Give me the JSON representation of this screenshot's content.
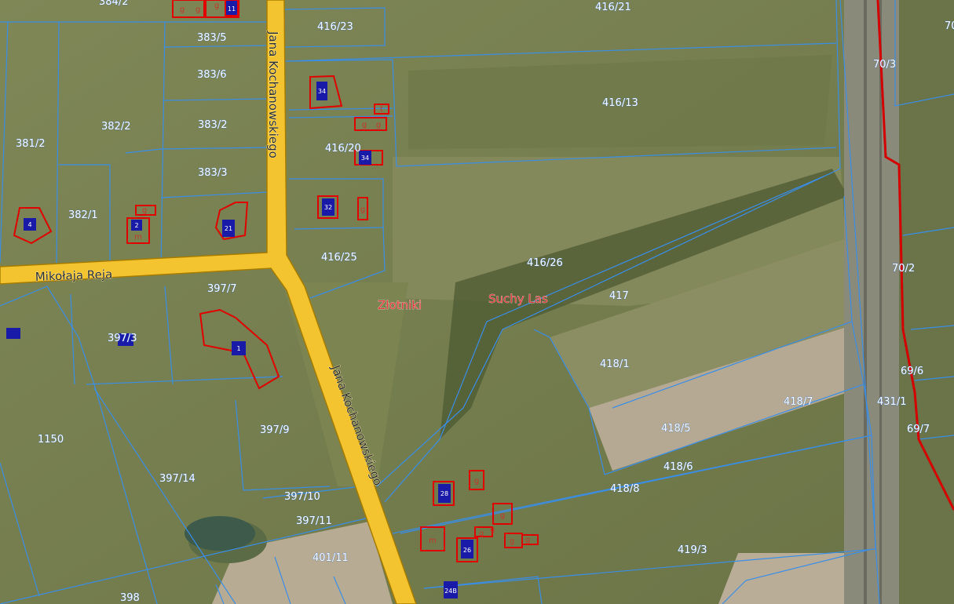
{
  "colors": {
    "parcel_boundary": "#3a8ee6",
    "road_fill": "#f4c430",
    "road_edge": "#a57c00",
    "building_outline": "#e00000",
    "building_fill_blue": "#1a1aa8",
    "railway_red": "#d40000",
    "place_label": "#e23a3a"
  },
  "streets": {
    "kochanowskiego_north": "Jana Kochanowskiego",
    "kochanowskiego_south": "Jana Kochanowskiego",
    "reja": "Mikołaja Reja"
  },
  "places": {
    "zlotniki": "Złotniki",
    "suchy_las": "Suchy Las"
  },
  "parcels": {
    "p384_2": "384/2",
    "p416_21": "416/21",
    "p416_23": "416/23",
    "p70_edge": "70",
    "p383_5": "383/5",
    "p70_3": "70/3",
    "p383_6": "383/6",
    "p416_13": "416/13",
    "p382_2": "382/2",
    "p383_2": "383/2",
    "p381_2": "381/2",
    "p416_20": "416/20",
    "p383_3": "383/3",
    "p382_1": "382/1",
    "p416_25": "416/25",
    "p416_26": "416/26",
    "p70_2": "70/2",
    "p397_7": "397/7",
    "p417": "417",
    "p397_3": "397/3",
    "p418_1": "418/1",
    "p69_6": "69/6",
    "p418_7": "418/7",
    "p431_1": "431/1",
    "p1150": "1150",
    "p397_9": "397/9",
    "p418_5": "418/5",
    "p69_7": "69/7",
    "p397_14": "397/14",
    "p418_6": "418/6",
    "p418_8": "418/8",
    "p397_10": "397/10",
    "p397_11": "397/11",
    "p419_3": "419/3",
    "p401_11": "401/11",
    "p398": "398"
  },
  "buildings": {
    "b34_top": "34",
    "b34": "34",
    "b32": "32",
    "b4": "4",
    "b2": "2",
    "b21": "21",
    "b28": "28",
    "b26": "26",
    "b24b": "24B",
    "b1": "1",
    "b11": "11",
    "g": "g",
    "m": "m",
    "t": "t"
  }
}
